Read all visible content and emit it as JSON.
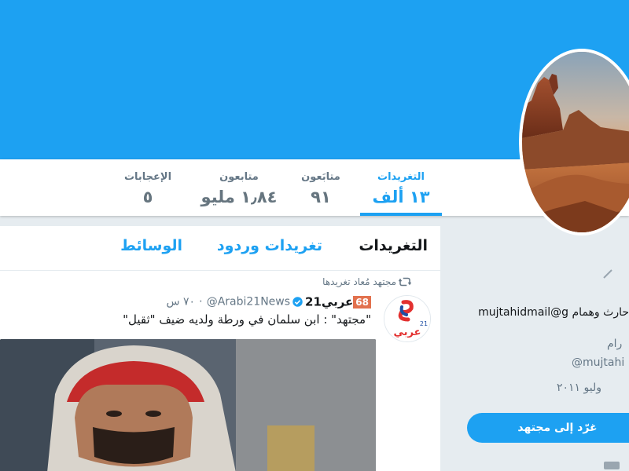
{
  "profile": {
    "stats": [
      {
        "label": "التغريدات",
        "value": "١٣ ألف",
        "active": true
      },
      {
        "label": "متابَعون",
        "value": "٩١",
        "active": false
      },
      {
        "label": "متابعون",
        "value": "١٫٨٤ مليو",
        "active": false
      },
      {
        "label": "الإعجابات",
        "value": "٥",
        "active": false
      }
    ],
    "bio_visible": "mujtahidmail@g حارث وهمام",
    "location_visible": "رام",
    "url_visible": "@mujtahi",
    "joined_visible": "وليو ٢٠١١",
    "tweet_to_label": "غرّد إلى مجتهد"
  },
  "timeline": {
    "tabs": [
      {
        "label": "التغريدات",
        "active": true
      },
      {
        "label": "تغريدات وردود",
        "active": false
      },
      {
        "label": "الوسائط",
        "active": false
      }
    ],
    "tweet": {
      "retweet_context": "مجتهد مُعاد تغريدها",
      "badge": "68",
      "author_name": "عربي21",
      "handle": "@Arabi21News",
      "separator": "·",
      "time": "٧٠ س",
      "text": "\"مجتهد\" : ابن سلمان في ورطة ولديه ضيف \"ثقيل\"",
      "avatar_brand_text": "عربي",
      "avatar_brand_number": "21"
    }
  },
  "colors": {
    "accent": "#1da1f2",
    "background": "#e6ecf0",
    "text_primary": "#14171a",
    "text_secondary": "#657786",
    "badge": "#e2714e"
  },
  "icons": {
    "retweet": "retweet-icon",
    "verified": "verified-badge-icon"
  }
}
